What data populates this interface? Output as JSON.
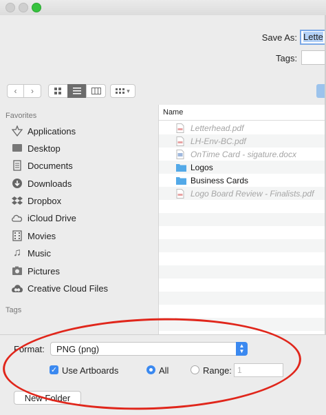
{
  "header": {
    "save_as_label": "Save As:",
    "save_as_value": "Lette",
    "tags_label": "Tags:"
  },
  "sidebar": {
    "favorites_heading": "Favorites",
    "tags_heading": "Tags",
    "items": [
      {
        "label": "Applications",
        "icon": "applications-icon"
      },
      {
        "label": "Desktop",
        "icon": "desktop-icon"
      },
      {
        "label": "Documents",
        "icon": "documents-icon"
      },
      {
        "label": "Downloads",
        "icon": "downloads-icon"
      },
      {
        "label": "Dropbox",
        "icon": "dropbox-icon"
      },
      {
        "label": "iCloud Drive",
        "icon": "cloud-icon"
      },
      {
        "label": "Movies",
        "icon": "movies-icon"
      },
      {
        "label": "Music",
        "icon": "music-icon"
      },
      {
        "label": "Pictures",
        "icon": "pictures-icon"
      },
      {
        "label": "Creative Cloud Files",
        "icon": "creative-cloud-icon"
      }
    ]
  },
  "file_list": {
    "column_name": "Name",
    "files": [
      {
        "name": "Letterhead.pdf",
        "type": "pdf",
        "enabled": false
      },
      {
        "name": "LH-Env-BC.pdf",
        "type": "pdf",
        "enabled": false
      },
      {
        "name": "OnTime Card - sigature.docx",
        "type": "docx",
        "enabled": false
      },
      {
        "name": "Logos",
        "type": "folder",
        "enabled": true
      },
      {
        "name": "Business Cards",
        "type": "folder",
        "enabled": true
      },
      {
        "name": "Logo Board Review - Finalists.pdf",
        "type": "pdf",
        "enabled": false
      }
    ]
  },
  "options": {
    "format_label": "Format:",
    "format_value": "PNG (png)",
    "use_artboards_label": "Use Artboards",
    "use_artboards_checked": true,
    "all_label": "All",
    "range_label": "Range:",
    "range_value": "1",
    "selected_scope": "All"
  },
  "footer": {
    "new_folder_label": "New Folder"
  },
  "colors": {
    "accent": "#3b89f0",
    "folder": "#53a9e8",
    "annotation": "#e0261b"
  }
}
